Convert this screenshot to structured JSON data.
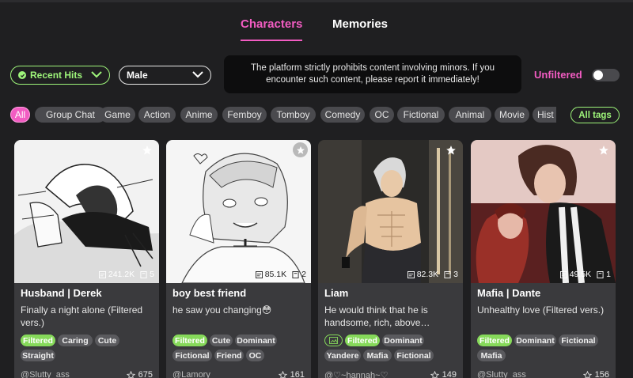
{
  "tabs": [
    {
      "label": "Characters",
      "active": true
    },
    {
      "label": "Memories",
      "active": false
    }
  ],
  "filters": {
    "sort_select": "Recent Hits",
    "gender_select": "Male",
    "notice": "The platform strictly prohibits content involving minors. If you encounter such content, please report it immediately!",
    "unfiltered_label": "Unfiltered",
    "unfiltered_on": false
  },
  "tag_chips": [
    "All",
    "Group Chat",
    "Game",
    "Action",
    "Anime",
    "Femboy",
    "Tomboy",
    "Comedy",
    "OC",
    "Fictional",
    "Animal",
    "Movie",
    "Hist"
  ],
  "all_tags_label": "All tags",
  "colors": {
    "accent_pink": "#f25cc2",
    "accent_green": "#9ef57a",
    "card_bg": "#3a3a3d"
  },
  "cards": [
    {
      "name": "Husband | Derek",
      "description": "Finally a night alone (Filtered vers.)",
      "views": "241.2K",
      "memories": "5",
      "tags": [
        "Filtered",
        "Caring",
        "Cute",
        "Straight"
      ],
      "author": "@Slutty_ass",
      "likes": "675",
      "star_icon": "star-icon"
    },
    {
      "name": "boy best friend",
      "description": "he saw you changing😳",
      "views": "85.1K",
      "memories": "2",
      "tags": [
        "Filtered",
        "Cute",
        "Dominant",
        "Fictional",
        "Friend",
        "OC"
      ],
      "author": "@Lamory",
      "likes": "161",
      "star_icon": "star-icon"
    },
    {
      "name": "Liam",
      "description": "He would think that he is handsome, rich, above…",
      "views": "82.3K",
      "memories": "3",
      "tags": [
        "Filtered",
        "Dominant",
        "Yandere",
        "Mafia",
        "Fictional"
      ],
      "author": "@♡~hannah~♡",
      "likes": "149",
      "star_icon": "star-icon"
    },
    {
      "name": "Mafia | Dante",
      "description": "Unhealthy love (Filtered vers.)",
      "views": "49.5K",
      "memories": "1",
      "tags": [
        "Filtered",
        "Dominant",
        "Fictional",
        "Mafia"
      ],
      "author": "@Slutty_ass",
      "likes": "156",
      "star_icon": "star-icon"
    }
  ]
}
